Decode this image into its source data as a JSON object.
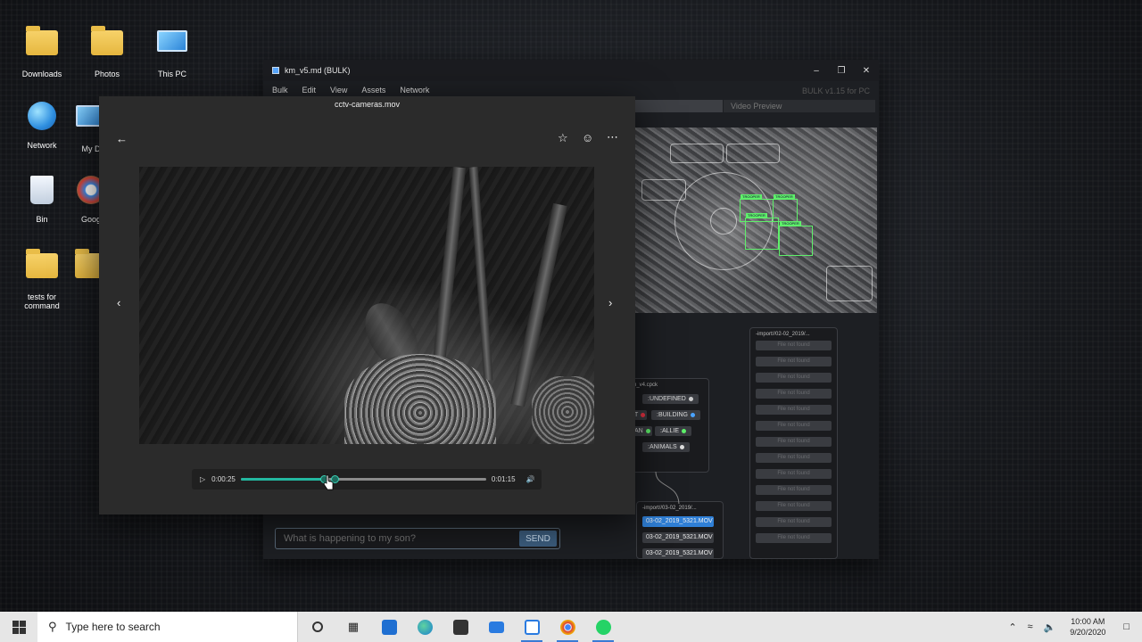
{
  "desktop": {
    "icons": [
      {
        "label": "Downloads"
      },
      {
        "label": "Photos"
      },
      {
        "label": "This PC"
      },
      {
        "label": "Network"
      },
      {
        "label": "My D"
      },
      {
        "label": "Bin"
      },
      {
        "label": "Goog"
      },
      {
        "label": "tests for command"
      }
    ]
  },
  "bulk_window": {
    "title": "km_v5.md (BULK)",
    "menu": [
      "Bulk",
      "Edit",
      "View",
      "Assets",
      "Network"
    ],
    "version": "BULK v1.15 for PC",
    "video_preview_tab": "Video Preview",
    "targets": [
      "TROOPER",
      "TROOPER",
      "TROOPER",
      "TROOPER"
    ],
    "node_cpck": {
      "title": "n_v4.cpck",
      "tags": [
        ":UNDEFINED",
        ":BUILDING",
        ":ALLIE",
        ":ANIMALS",
        "T",
        "AN"
      ]
    },
    "node_import1": {
      "title": "-import//03-02_2019/...",
      "files": [
        "03-02_2019_5321.MOV",
        "03-02_2019_5321.MOV",
        "03-02_2019_5321.MOV"
      ]
    },
    "node_import2": {
      "title": "-import//02-02_2019/...",
      "not_found": "File not found"
    }
  },
  "viewer": {
    "file_name": "cctv-cameras.mov",
    "player": {
      "current_time": "0:00:25",
      "total_time": "0:01:15",
      "progress": 0.34
    }
  },
  "message": {
    "placeholder": "What is happening to my son?",
    "send_label": "SEND"
  },
  "taskbar": {
    "search_placeholder": "Type here to search",
    "time": "10:00 AM",
    "date": "9/20/2020"
  },
  "colors": {
    "accent": "#23b8a0",
    "selection": "#2f7fd6",
    "target_box": "#5ef06a"
  }
}
